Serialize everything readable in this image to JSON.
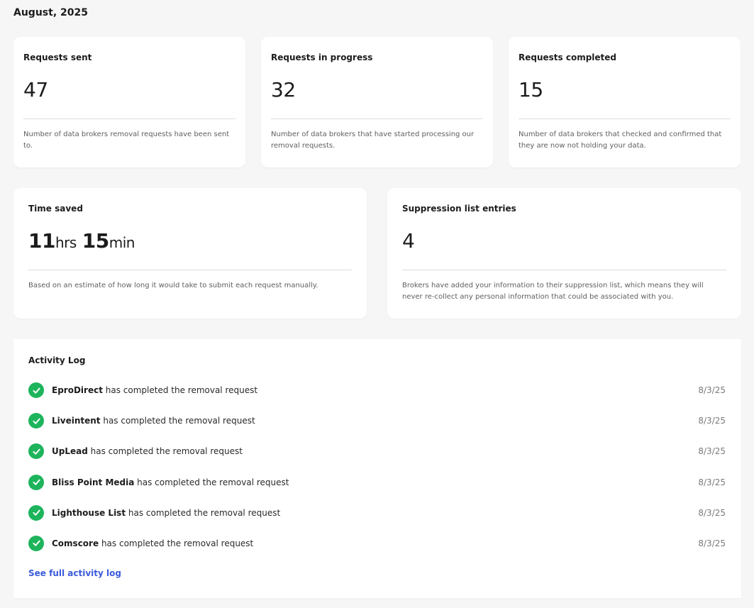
{
  "period": "August, 2025",
  "stats": {
    "sent": {
      "title": "Requests sent",
      "value": "47",
      "desc": "Number of data brokers removal requests have been sent to."
    },
    "progress": {
      "title": "Requests in progress",
      "value": "32",
      "desc": "Number of data brokers that have started processing our removal requests."
    },
    "completed": {
      "title": "Requests completed",
      "value": "15",
      "desc": "Number of data brokers that checked and confirmed that they are now not holding your data."
    }
  },
  "time_saved": {
    "title": "Time saved",
    "hours": "11",
    "hours_unit": "hrs",
    "minutes": "15",
    "minutes_unit": "min",
    "desc": "Based on an estimate of how long it would take to submit each request manually."
  },
  "suppression": {
    "title": "Suppression list entries",
    "value": "4",
    "desc": "Brokers have added your information to their suppression list, which means they will never re-collect any personal information that could be associated with you."
  },
  "activity": {
    "title": "Activity Log",
    "items": [
      {
        "broker": "EproDirect",
        "text": " has completed the removal request",
        "date": "8/3/25"
      },
      {
        "broker": "Liveintent",
        "text": " has completed the removal request",
        "date": "8/3/25"
      },
      {
        "broker": "UpLead",
        "text": " has completed the removal request",
        "date": "8/3/25"
      },
      {
        "broker": "Bliss Point Media",
        "text": " has completed the removal request",
        "date": "8/3/25"
      },
      {
        "broker": "Lighthouse List",
        "text": " has completed the removal request",
        "date": "8/3/25"
      },
      {
        "broker": "Comscore",
        "text": " has completed the removal request",
        "date": "8/3/25"
      }
    ],
    "see_full_label": "See full activity log"
  },
  "colors": {
    "check": "#1db45c",
    "link": "#3b5bdb"
  },
  "icons": {
    "status": "check-circle-icon"
  }
}
